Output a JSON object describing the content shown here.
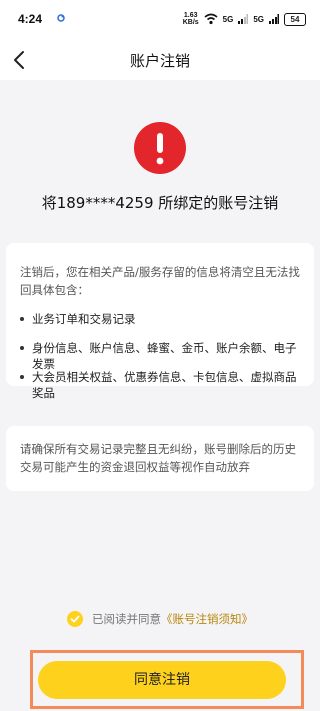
{
  "status_bar": {
    "time": "4:24",
    "net_speed_value": "1.63",
    "net_speed_unit": "KB/s",
    "signal_label_1": "5G",
    "signal_label_2": "5G",
    "battery": "54"
  },
  "header": {
    "title": "账户注销",
    "back_icon": "chevron-left-icon"
  },
  "hero": {
    "alert_icon": "exclamation-circle-icon",
    "alert_color": "#e3262b",
    "account_text": "将189****4259 所绑定的账号注销"
  },
  "info_card": {
    "intro": "注销后，您在相关产品/服务存留的信息将清空且无法找回具体包含：",
    "items": [
      "业务订单和交易记录",
      "身份信息、账户信息、蜂蜜、金币、账户余额、电子发票",
      "大会员相关权益、优惠券信息、卡包信息、虚拟商品奖品"
    ]
  },
  "warning_card": {
    "text": "请确保所有交易记录完整且无纠纷，账号删除后的历史交易可能产生的资金退回权益等视作自动放弃"
  },
  "agreement": {
    "checked": true,
    "check_color": "#fed21c",
    "text": "已阅读并同意",
    "link": "《账号注销须知》",
    "link_color": "#b8860b"
  },
  "confirm_button": {
    "label": "同意注销",
    "color": "#fed21c",
    "highlight_border_color": "#f28a5a"
  }
}
